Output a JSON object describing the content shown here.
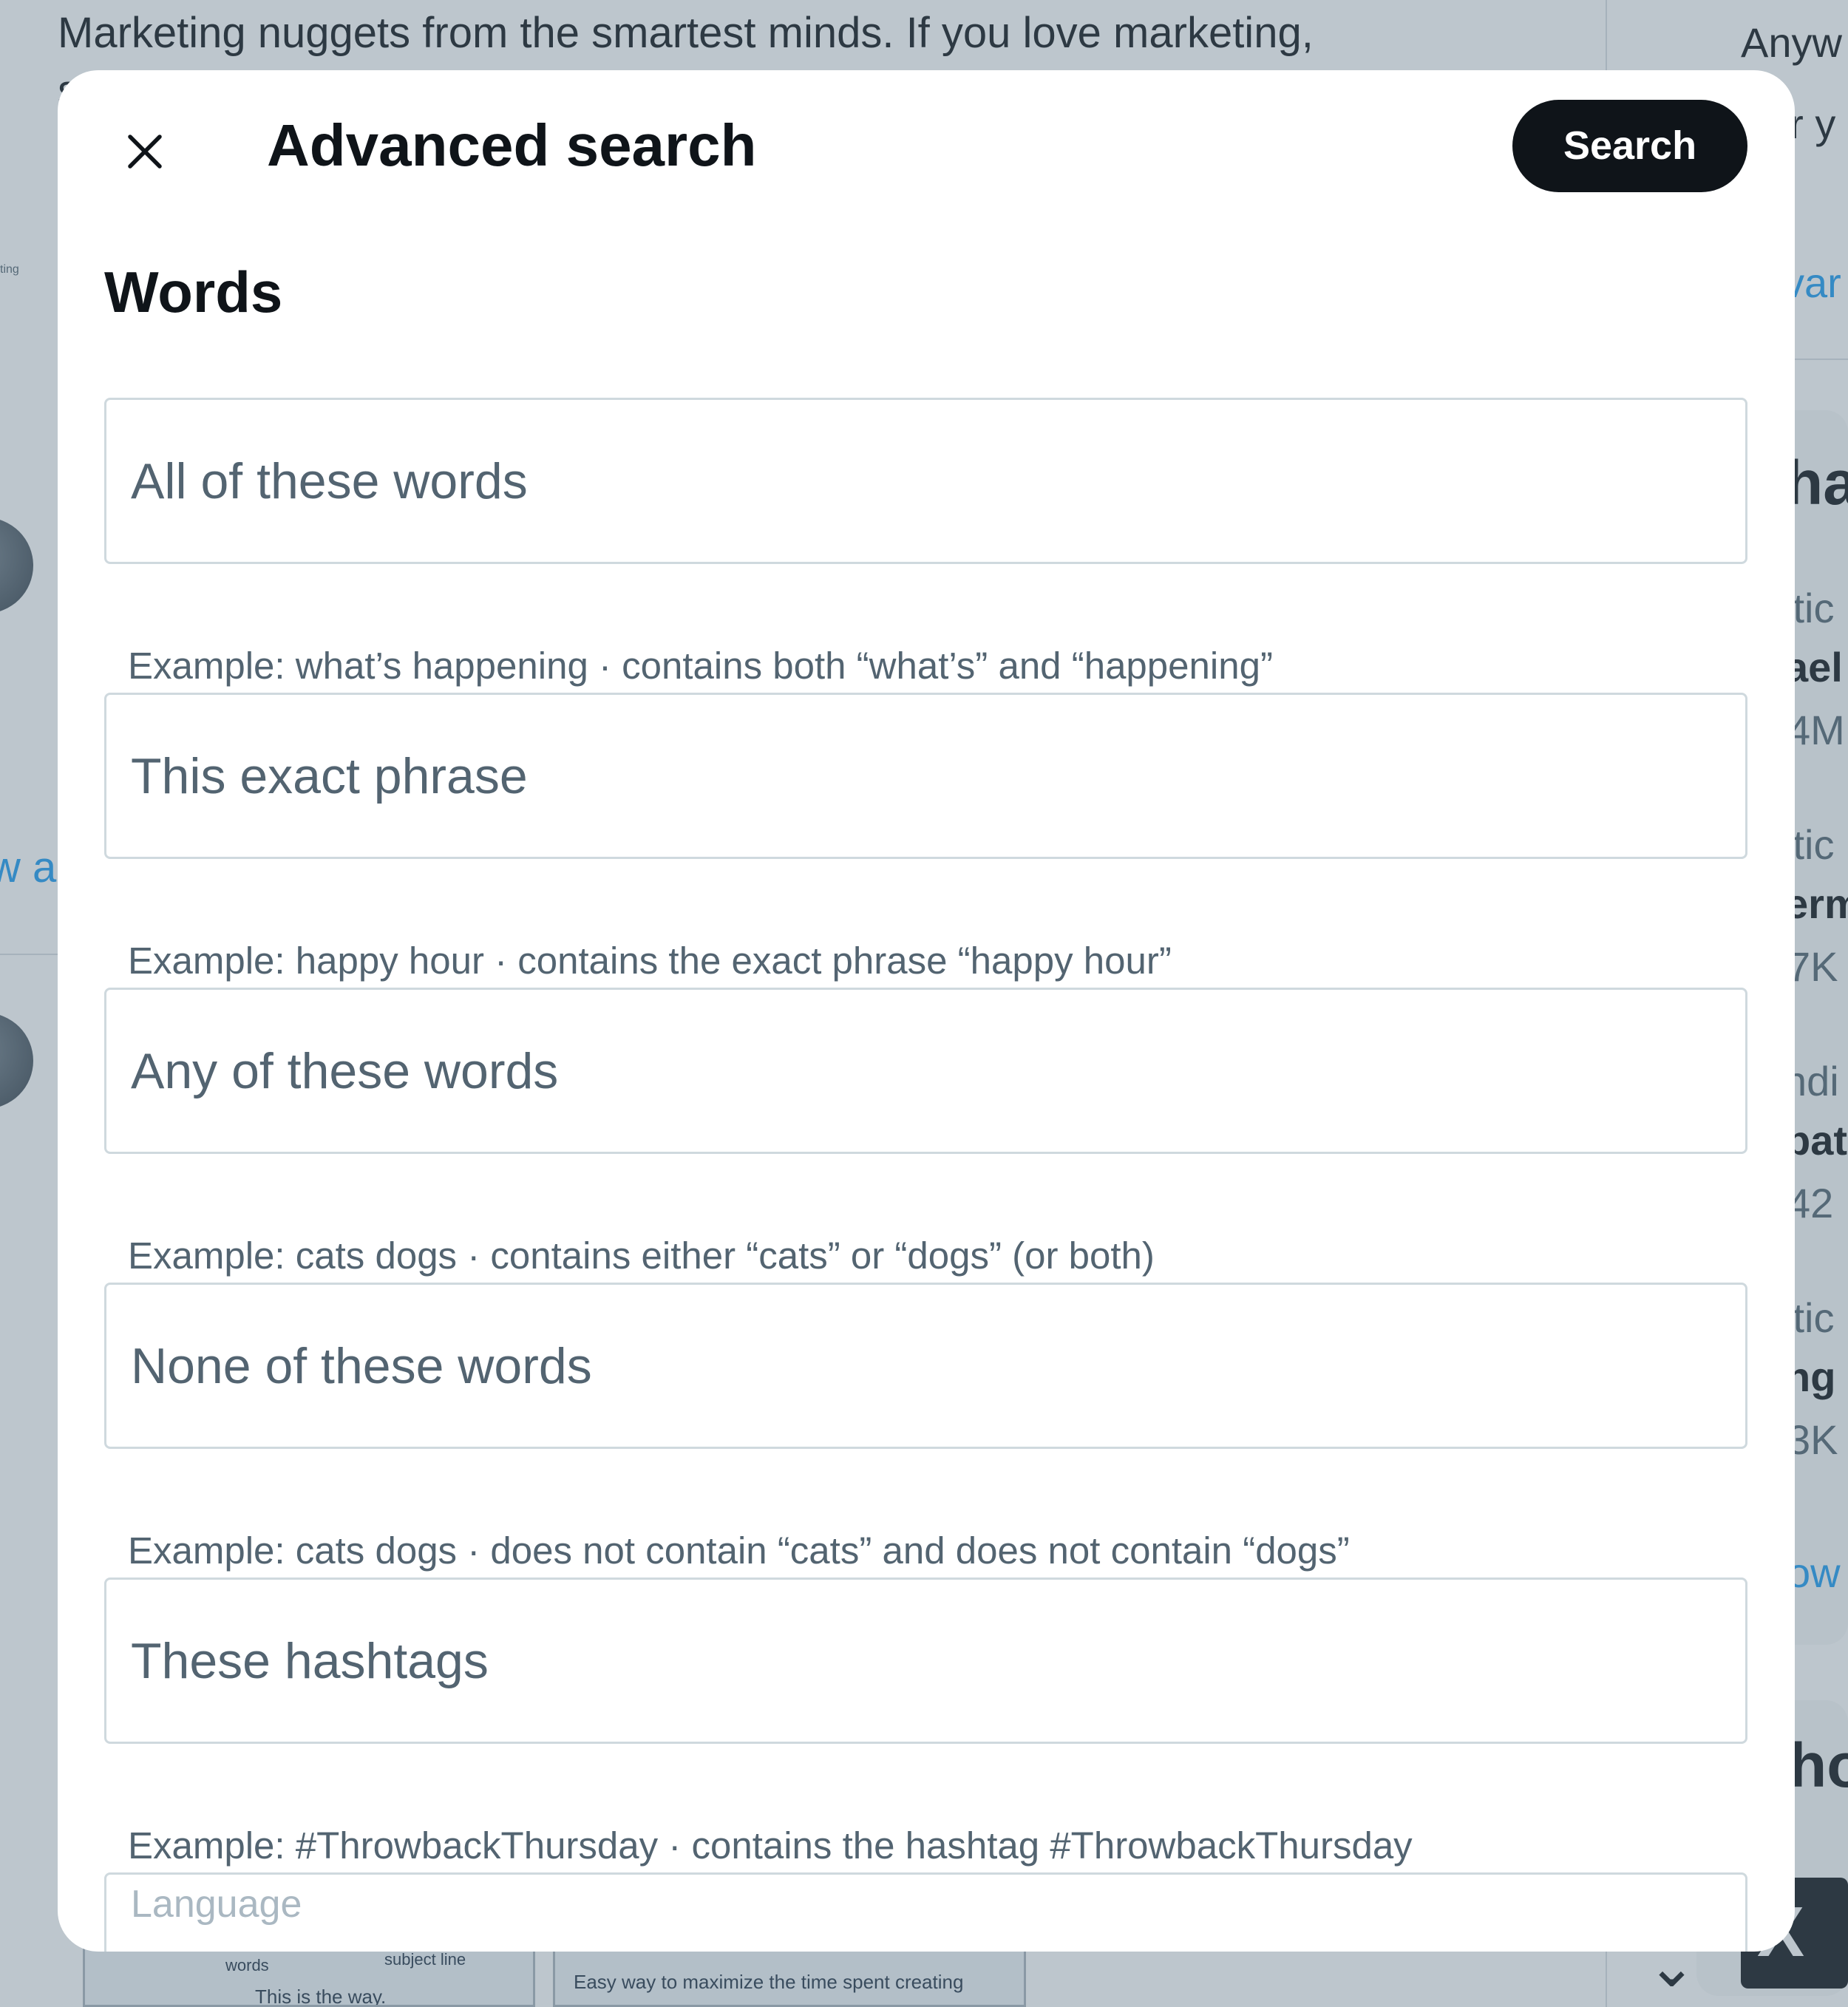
{
  "background": {
    "tweet_text": "Marketing nuggets from the smartest minds. If you love marketing,",
    "tweet_cont": "s",
    "show_all": "w al",
    "tiny_label": "ting",
    "thumb1_words": "words",
    "thumb1_subject": "subject line",
    "thumb1_way": "This is the way.",
    "thumb2_caption": "Easy way to maximize the time spent creating",
    "right_col": {
      "r1": "Anyw",
      "r2": "ar y",
      "r3": "var",
      "r4": "ha",
      "r5": "itic",
      "r6": "ael",
      "r7": "4M",
      "r8": "itic",
      "r9": "erm",
      "r10": "7K",
      "r11": "ndi",
      "r12": "pat",
      "r13": "42",
      "r14": "itic",
      "r15": "ng",
      "r16": "3K",
      "r17": "ow",
      "r18": "ho"
    },
    "x_tile_glyph": "X",
    "chevron_glyph": "⌄"
  },
  "modal": {
    "title": "Advanced search",
    "search_button": "Search",
    "section_title": "Words",
    "fields": [
      {
        "placeholder": "All of these words",
        "value": "",
        "hint": "Example: what’s happening · contains both “what’s” and “happening”"
      },
      {
        "placeholder": "This exact phrase",
        "value": "",
        "hint": "Example: happy hour · contains the exact phrase “happy hour”"
      },
      {
        "placeholder": "Any of these words",
        "value": "",
        "hint": "Example: cats dogs · contains either “cats” or “dogs” (or both)"
      },
      {
        "placeholder": "None of these words",
        "value": "",
        "hint": "Example: cats dogs · does not contain “cats” and does not contain “dogs”"
      },
      {
        "placeholder": "These hashtags",
        "value": "",
        "hint": "Example: #ThrowbackThursday · contains the hashtag #ThrowbackThursday"
      }
    ],
    "language_label": "Language"
  },
  "icons": {
    "close": "close-icon"
  },
  "colors": {
    "primary_button_bg": "#0f1419",
    "text_primary": "#0f1419",
    "text_secondary": "#536471",
    "border": "#cfd9de",
    "link": "#1d9bf0",
    "overlay": "rgba(91,112,131,0.40)"
  }
}
